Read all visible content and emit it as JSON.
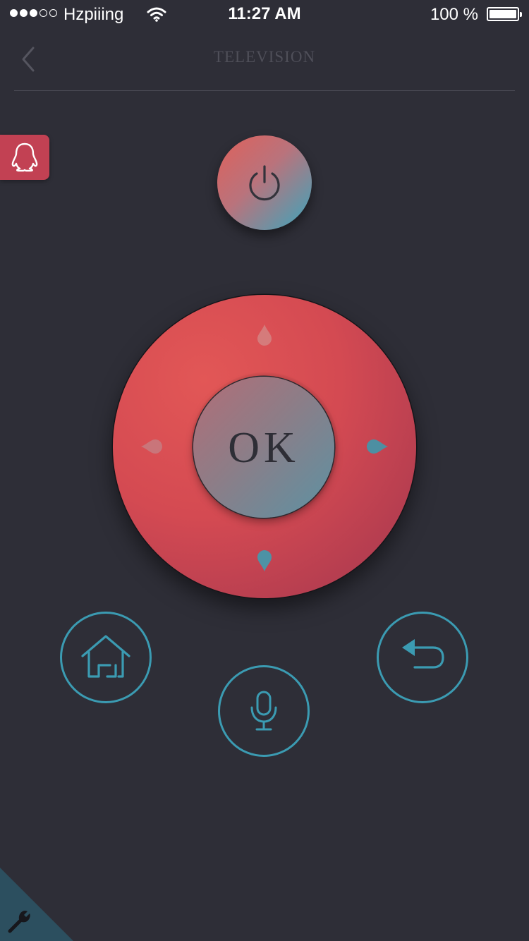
{
  "status_bar": {
    "signal_dots": "●●●○○",
    "carrier": "Hzpiiing",
    "time": "11:27 AM",
    "battery": "100 %",
    "battery_level": 1.0
  },
  "nav": {
    "title": "TELEVISION",
    "back_icon": "chevron-left-icon"
  },
  "side_tab": {
    "icon": "qq-penguin-icon",
    "color": "#c24153"
  },
  "remote": {
    "power_icon": "power-icon",
    "ok_label": "OK",
    "home_icon": "home-icon",
    "mic_icon": "microphone-icon",
    "return_icon": "return-arrow-icon",
    "settings_icon": "wrench-icon"
  },
  "colors": {
    "background": "#2e2e37",
    "dpad": "#d44a52",
    "accent": "#3b9bb2"
  }
}
